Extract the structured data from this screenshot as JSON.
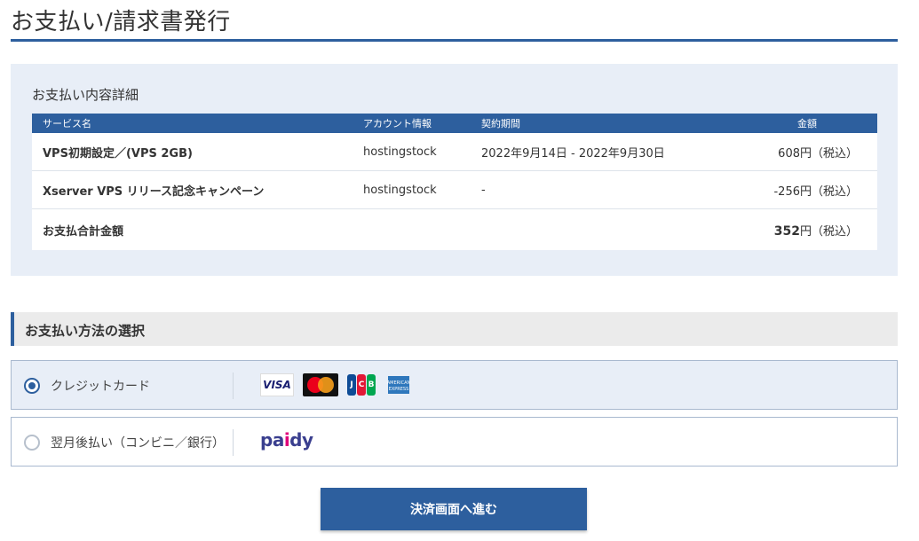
{
  "page": {
    "title": "お支払い/請求書発行"
  },
  "details": {
    "heading": "お支払い内容詳細",
    "columns": [
      "サービス名",
      "アカウント情報",
      "契約期間",
      "金額"
    ],
    "rows": [
      {
        "service": "VPS初期設定／(VPS 2GB)",
        "account": "hostingstock",
        "period": "2022年9月14日 - 2022年9月30日",
        "amount": "608円（税込）"
      },
      {
        "service": "Xserver VPS リリース記念キャンペーン",
        "account": "hostingstock",
        "period": "-",
        "amount": "-256円（税込）"
      }
    ],
    "total": {
      "label": "お支払合計金額",
      "amount": "352",
      "suffix": "円（税込）"
    }
  },
  "payment_method": {
    "heading": "お支払い方法の選択",
    "options": [
      {
        "label": "クレジットカード",
        "selected": true,
        "logos": [
          "visa-icon",
          "mastercard-icon",
          "jcb-icon",
          "amex-icon"
        ]
      },
      {
        "label": "翌月後払い（コンビニ／銀行）",
        "selected": false,
        "logos": [
          "paidy-icon"
        ]
      }
    ],
    "visa_text": "VISA",
    "jcb_letters": [
      "J",
      "C",
      "B"
    ],
    "amex_text": "AMERICAN EXPRESS",
    "paidy_text": {
      "a": "pa",
      "b": "i",
      "c": "dy"
    }
  },
  "actions": {
    "proceed_label": "決済画面へ進む"
  },
  "colors": {
    "accent": "#2d5f9e",
    "panel_bg": "#e8eef7"
  }
}
